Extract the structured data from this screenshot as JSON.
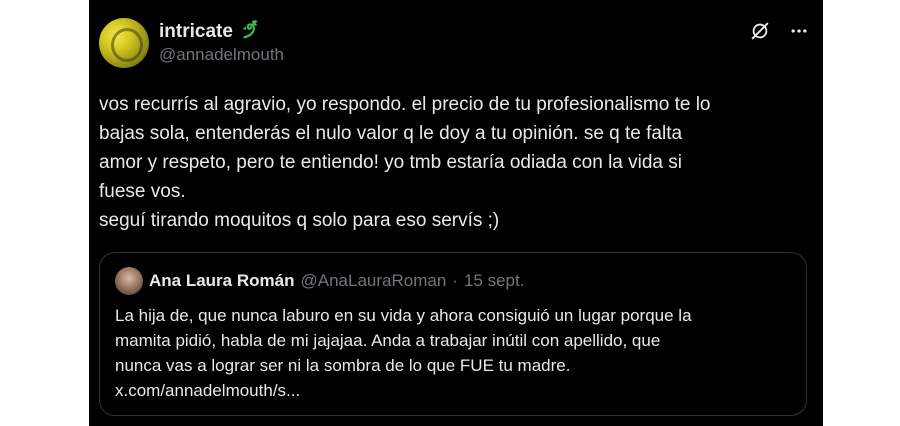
{
  "author": {
    "display_name": "intricate",
    "handle": "@annadelmouth",
    "emoji_icon": "dragon-icon"
  },
  "tweet": {
    "text": "vos recurrís al agravio, yo respondo. el precio de tu profesionalismo te lo\nbajas sola, entenderás el nulo valor q le doy a tu opinión. se q te falta\namor y respeto, pero te entiendo! yo tmb estaría odiada con la vida si\nfuese vos.\nseguí tirando moquitos q solo para eso servís ;)"
  },
  "quoted": {
    "display_name": "Ana Laura Román",
    "handle": "@AnaLauraRoman",
    "separator": "·",
    "date": "15 sept.",
    "text": "La hija de, que nunca laburo en su vida y ahora consiguió un lugar porque la\nmamita pidió, habla de mi jajajaa. Anda a trabajar inútil con apellido, que\nnunca vas a lograr ser ni la sombra de lo que FUE tu madre.\nx.com/annadelmouth/s..."
  },
  "colors": {
    "background": "#000000",
    "text": "#e7e9ea",
    "secondary_text": "#71767b",
    "border": "#2f3336",
    "emoji_green": "#3fb950"
  }
}
